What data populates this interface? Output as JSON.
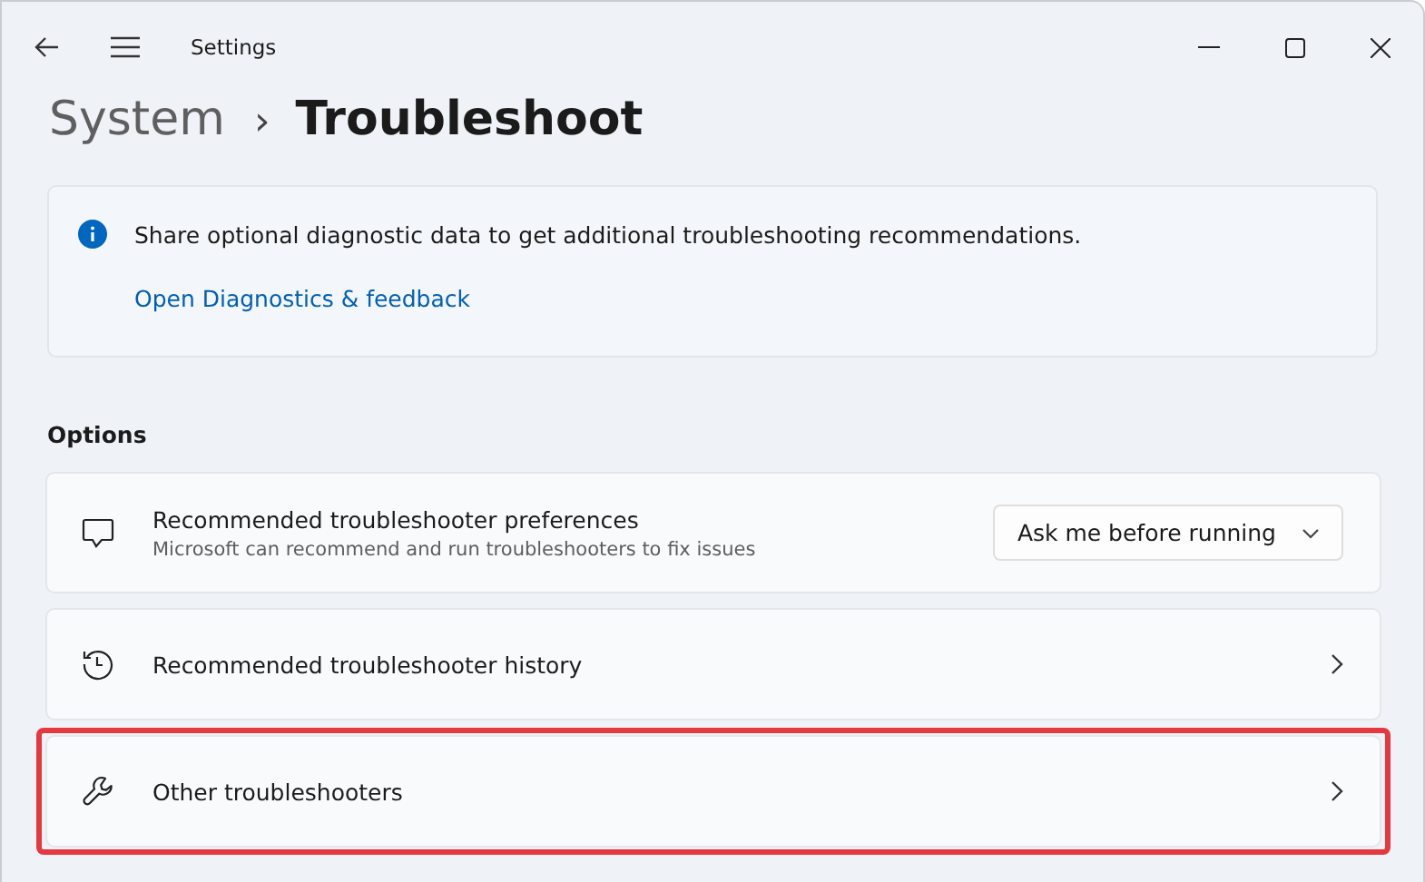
{
  "window": {
    "title": "Settings"
  },
  "breadcrumb": {
    "parent": "System",
    "separator": "›",
    "current": "Troubleshoot"
  },
  "info_card": {
    "message": "Share optional diagnostic data to get additional troubleshooting recommendations.",
    "link": "Open Diagnostics & feedback"
  },
  "section_title": "Options",
  "rows": [
    {
      "kind": "dropdown",
      "title": "Recommended troubleshooter preferences",
      "subtitle": "Microsoft can recommend and run troubleshooters to fix issues",
      "value": "Ask me before running",
      "highlighted": false
    },
    {
      "kind": "link",
      "title": "Recommended troubleshooter history",
      "highlighted": false
    },
    {
      "kind": "link",
      "title": "Other troubleshooters",
      "highlighted": true
    }
  ]
}
